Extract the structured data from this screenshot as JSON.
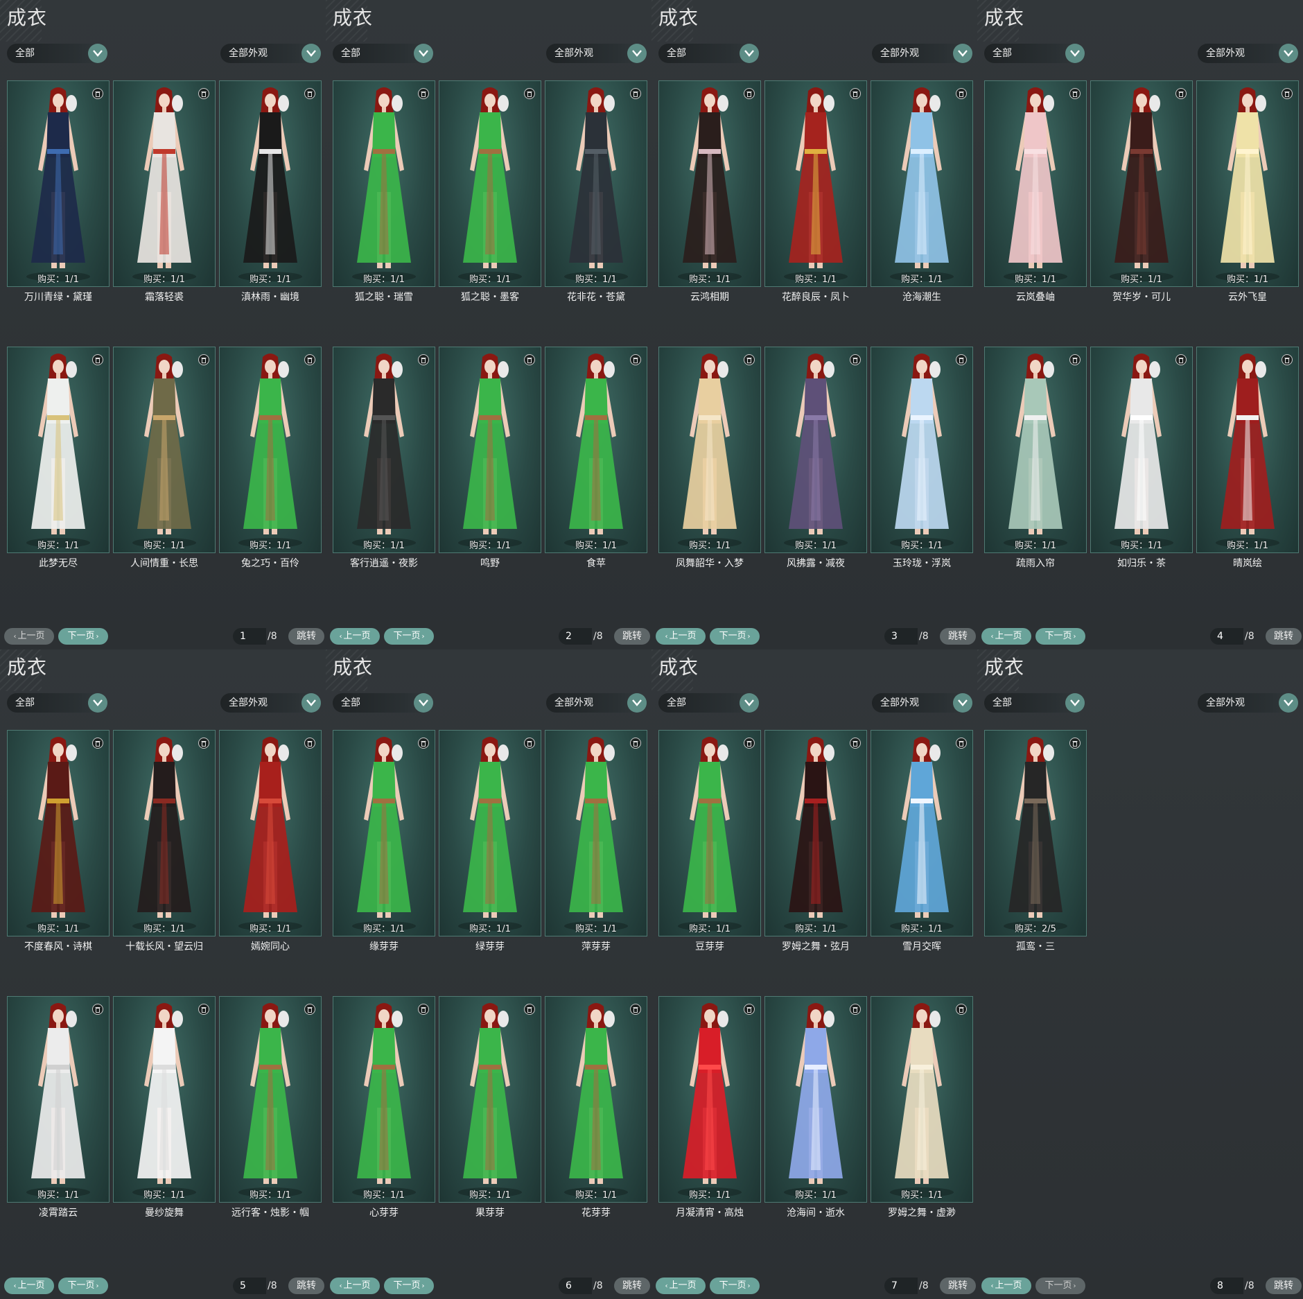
{
  "panels": [
    {
      "title": "成衣",
      "filter_left": "全部",
      "filter_right": "全部外观",
      "page": "1",
      "total": "/8",
      "prev": "上一页",
      "next": "下一页",
      "jump": "跳转",
      "prev_enabled": false,
      "items": [
        {
          "buy": "购买：1/1",
          "name": "万川青绿・黛瑾",
          "color": "#1d2a4a",
          "accent": "#3e6bb0"
        },
        {
          "buy": "购买：1/1",
          "name": "霜落轻裘",
          "color": "#e8e4e0",
          "accent": "#c0392b"
        },
        {
          "buy": "购买：1/1",
          "name": "滇林雨・幽境",
          "color": "#1a1a1a",
          "accent": "#e6e6e6"
        },
        {
          "buy": "购买：1/1",
          "name": "此梦无尽",
          "color": "#eef0ee",
          "accent": "#d8c27a"
        },
        {
          "buy": "购买：1/1",
          "name": "人间情重・长思",
          "color": "#6f6a48",
          "accent": "#c9a66b"
        },
        {
          "buy": "购买：1/1",
          "name": "兔之巧・百伶",
          "color": "#3bb54a",
          "accent": "#a07040"
        }
      ]
    },
    {
      "title": "成衣",
      "filter_left": "全部",
      "filter_right": "全部外观",
      "page": "2",
      "total": "/8",
      "prev": "上一页",
      "next": "下一页",
      "jump": "跳转",
      "prev_enabled": true,
      "items": [
        {
          "buy": "购买：1/1",
          "name": "狐之聪・瑞雪",
          "color": "#3bb54a",
          "accent": "#a07040"
        },
        {
          "buy": "购买：1/1",
          "name": "狐之聪・墨客",
          "color": "#3bb54a",
          "accent": "#a07040"
        },
        {
          "buy": "购买：1/1",
          "name": "花非花・苍黛",
          "color": "#2b3138",
          "accent": "#555e66"
        },
        {
          "buy": "购买：1/1",
          "name": "客行逍遥・夜影",
          "color": "#2a2a2a",
          "accent": "#555555"
        },
        {
          "buy": "购买：1/1",
          "name": "鸣野",
          "color": "#3bb54a",
          "accent": "#a07040"
        },
        {
          "buy": "购买：1/1",
          "name": "食苹",
          "color": "#3bb54a",
          "accent": "#a07040"
        }
      ]
    },
    {
      "title": "成衣",
      "filter_left": "全部",
      "filter_right": "全部外观",
      "page": "3",
      "total": "/8",
      "prev": "上一页",
      "next": "下一页",
      "jump": "跳转",
      "prev_enabled": true,
      "items": [
        {
          "buy": "购买：1/1",
          "name": "云鸿相期",
          "color": "#2a1e1c",
          "accent": "#d8b9c0"
        },
        {
          "buy": "购买：1/1",
          "name": "花醉良辰・凤卜",
          "color": "#a5231e",
          "accent": "#e0b040"
        },
        {
          "buy": "购买：1/1",
          "name": "沧海潮生",
          "color": "#8fc2e6",
          "accent": "#dcefff"
        },
        {
          "buy": "购买：1/1",
          "name": "凤舞韶华・入梦",
          "color": "#e8cfa0",
          "accent": "#f5e6c8"
        },
        {
          "buy": "购买：1/1",
          "name": "风拂露・减夜",
          "color": "#5e5078",
          "accent": "#8a7aa8"
        },
        {
          "buy": "购买：1/1",
          "name": "玉玲珑・浮岚",
          "color": "#bcd8f0",
          "accent": "#eaf4ff"
        }
      ]
    },
    {
      "title": "成衣",
      "filter_left": "全部",
      "filter_right": "全部外观",
      "page": "4",
      "total": "/8",
      "prev": "上一页",
      "next": "下一页",
      "jump": "跳转",
      "prev_enabled": true,
      "items": [
        {
          "buy": "购买：1/1",
          "name": "云岚叠岫",
          "color": "#efc6c8",
          "accent": "#f8e0e2"
        },
        {
          "buy": "购买：1/1",
          "name": "贺华岁・可儿",
          "color": "#3a1c1a",
          "accent": "#7a3a32"
        },
        {
          "buy": "购买：1/1",
          "name": "云外飞皇",
          "color": "#efe2a8",
          "accent": "#fff4cf"
        },
        {
          "buy": "购买：1/1",
          "name": "疏雨入帘",
          "color": "#a8c8b8",
          "accent": "#f0f0f0"
        },
        {
          "buy": "购买：1/1",
          "name": "如归乐・茶",
          "color": "#e8e8e8",
          "accent": "#ffffff"
        },
        {
          "buy": "购买：1/1",
          "name": "晴岚绘",
          "color": "#9e1e1e",
          "accent": "#f2f2f2"
        }
      ]
    },
    {
      "title": "成衣",
      "filter_left": "全部",
      "filter_right": "全部外观",
      "page": "5",
      "total": "/8",
      "prev": "上一页",
      "next": "下一页",
      "jump": "跳转",
      "prev_enabled": true,
      "items": [
        {
          "buy": "购买：1/1",
          "name": "不度春风・诗棋",
          "color": "#5a1a16",
          "accent": "#d0a030"
        },
        {
          "buy": "购买：1/1",
          "name": "十载长风・望云归",
          "color": "#241c1c",
          "accent": "#8a2a22"
        },
        {
          "buy": "购买：1/1",
          "name": "嫣婉同心",
          "color": "#a8201c",
          "accent": "#d84a3a"
        },
        {
          "buy": "购买：1/1",
          "name": "凌霄踏云",
          "color": "#ececec",
          "accent": "#d0d0d0"
        },
        {
          "buy": "购买：1/1",
          "name": "曼纱旋舞",
          "color": "#f4f4f4",
          "accent": "#dcdcdc"
        },
        {
          "buy": "购买：1/1",
          "name": "远行客・烛影・帼",
          "color": "#3bb54a",
          "accent": "#a07040"
        }
      ]
    },
    {
      "title": "成衣",
      "filter_left": "全部",
      "filter_right": "全部外观",
      "page": "6",
      "total": "/8",
      "prev": "上一页",
      "next": "下一页",
      "jump": "跳转",
      "prev_enabled": true,
      "items": [
        {
          "buy": "购买：1/1",
          "name": "缘芽芽",
          "color": "#3bb54a",
          "accent": "#a07040"
        },
        {
          "buy": "购买：1/1",
          "name": "绿芽芽",
          "color": "#3bb54a",
          "accent": "#a07040"
        },
        {
          "buy": "购买：1/1",
          "name": "萍芽芽",
          "color": "#3bb54a",
          "accent": "#a07040"
        },
        {
          "buy": "购买：1/1",
          "name": "心芽芽",
          "color": "#3bb54a",
          "accent": "#a07040"
        },
        {
          "buy": "购买：1/1",
          "name": "果芽芽",
          "color": "#3bb54a",
          "accent": "#a07040"
        },
        {
          "buy": "购买：1/1",
          "name": "花芽芽",
          "color": "#3bb54a",
          "accent": "#a07040"
        }
      ]
    },
    {
      "title": "成衣",
      "filter_left": "全部",
      "filter_right": "全部外观",
      "page": "7",
      "total": "/8",
      "prev": "上一页",
      "next": "下一页",
      "jump": "跳转",
      "prev_enabled": true,
      "items": [
        {
          "buy": "购买：1/1",
          "name": "豆芽芽",
          "color": "#3bb54a",
          "accent": "#a07040"
        },
        {
          "buy": "购买：1/1",
          "name": "罗姆之舞・弦月",
          "color": "#2a1414",
          "accent": "#a82020"
        },
        {
          "buy": "购买：1/1",
          "name": "雪月交晖",
          "color": "#5fa6d8",
          "accent": "#f0f6ff"
        },
        {
          "buy": "购买：1/1",
          "name": "月凝清宵・高烛",
          "color": "#d81e28",
          "accent": "#ff4a4a"
        },
        {
          "buy": "购买：1/1",
          "name": "沧海间・逝水",
          "color": "#8ea8e8",
          "accent": "#e8eeff"
        },
        {
          "buy": "购买：1/1",
          "name": "罗姆之舞・虚渺",
          "color": "#e8dcc0",
          "accent": "#f8f0dc"
        }
      ]
    },
    {
      "title": "成衣",
      "filter_left": "全部",
      "filter_right": "全部外观",
      "page": "8",
      "total": "/8",
      "prev": "上一页",
      "next": "下一页",
      "jump": "跳转",
      "prev_enabled": true,
      "items": [
        {
          "buy": "购买：2/5",
          "name": "孤鸾・三",
          "color": "#262626",
          "accent": "#7a6a5a"
        }
      ]
    }
  ]
}
